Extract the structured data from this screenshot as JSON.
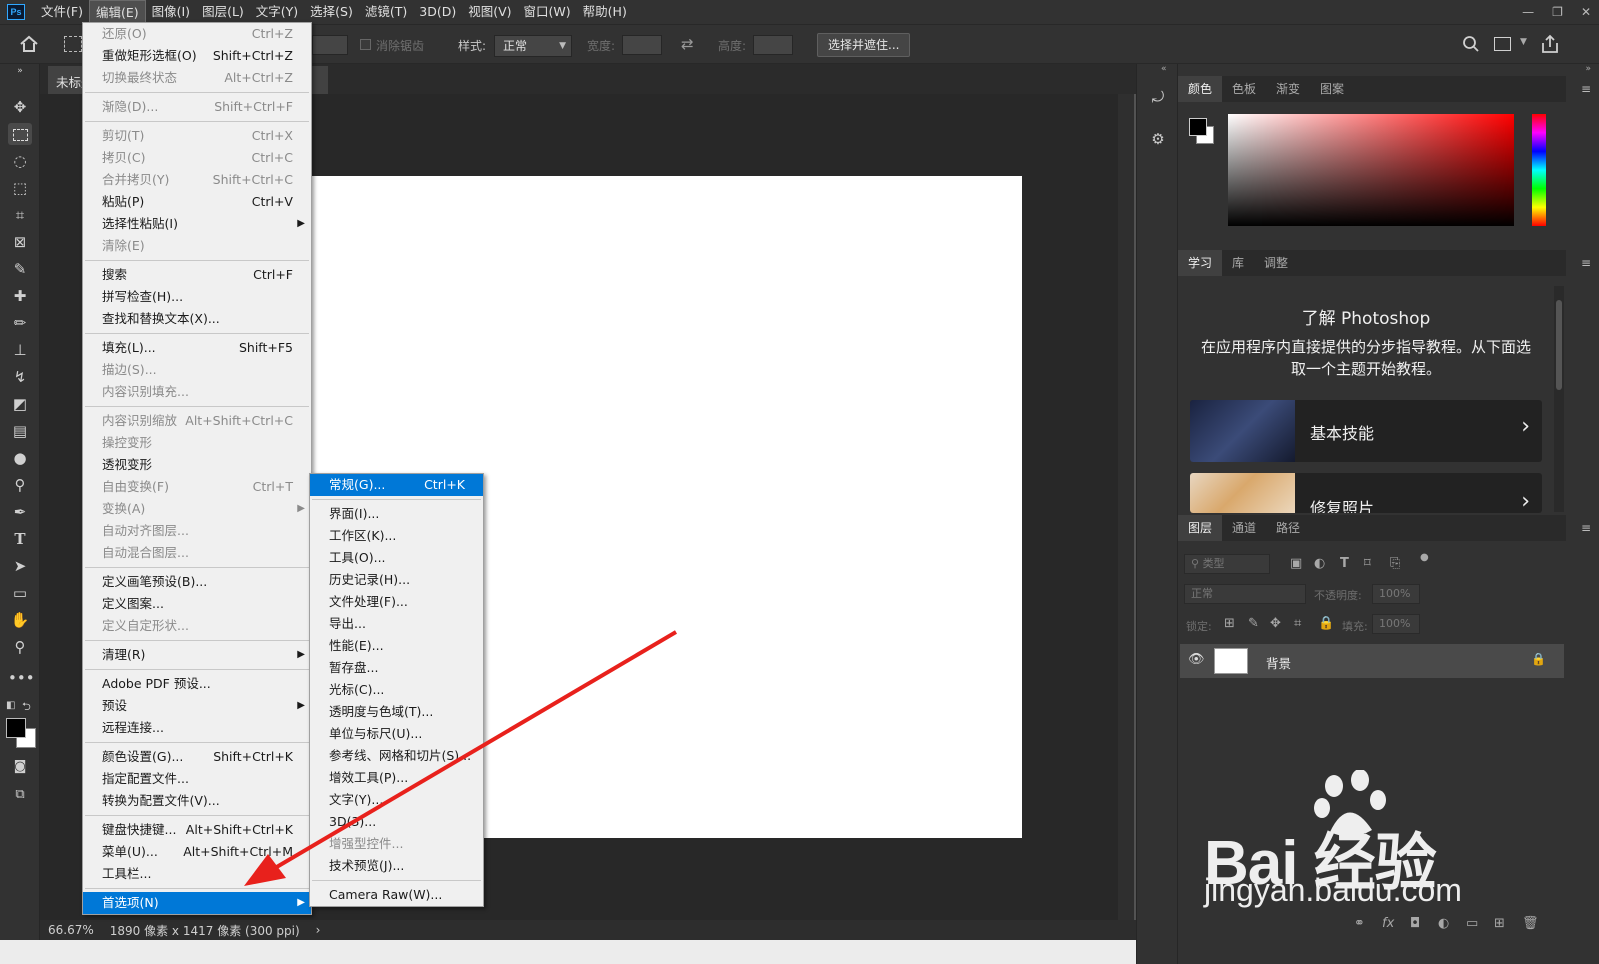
{
  "app": {
    "logo": "Ps"
  },
  "menubar": {
    "items": [
      "文件(F)",
      "编辑(E)",
      "图像(I)",
      "图层(L)",
      "文字(Y)",
      "选择(S)",
      "滤镜(T)",
      "3D(D)",
      "视图(V)",
      "窗口(W)",
      "帮助(H)"
    ],
    "active_index": 1,
    "window_controls": [
      "—",
      "❐",
      "✕"
    ]
  },
  "options": {
    "antialias_label": "消除锯齿",
    "style_label": "样式:",
    "style_value": "正常",
    "width_label": "宽度:",
    "height_label": "高度:",
    "select_mask_button": "选择并遮住..."
  },
  "document": {
    "tab_title": "未标题",
    "zoom": "66.67%",
    "info": "1890 像素 x 1417 像素 (300 ppi)",
    "info_arrow": "›"
  },
  "edit_menu": {
    "items": [
      {
        "label": "还原(O)",
        "shortcut": "Ctrl+Z",
        "disabled": true
      },
      {
        "label": "重做矩形选框(O)",
        "shortcut": "Shift+Ctrl+Z",
        "disabled": false
      },
      {
        "label": "切换最终状态",
        "shortcut": "Alt+Ctrl+Z",
        "disabled": true
      },
      {
        "sep": true
      },
      {
        "label": "渐隐(D)...",
        "shortcut": "Shift+Ctrl+F",
        "disabled": true
      },
      {
        "sep": true
      },
      {
        "label": "剪切(T)",
        "shortcut": "Ctrl+X",
        "disabled": true
      },
      {
        "label": "拷贝(C)",
        "shortcut": "Ctrl+C",
        "disabled": true
      },
      {
        "label": "合并拷贝(Y)",
        "shortcut": "Shift+Ctrl+C",
        "disabled": true
      },
      {
        "label": "粘贴(P)",
        "shortcut": "Ctrl+V",
        "disabled": false
      },
      {
        "label": "选择性粘贴(I)",
        "shortcut": "",
        "disabled": false,
        "submenu": true
      },
      {
        "label": "清除(E)",
        "shortcut": "",
        "disabled": true
      },
      {
        "sep": true
      },
      {
        "label": "搜索",
        "shortcut": "Ctrl+F",
        "disabled": false
      },
      {
        "label": "拼写检查(H)...",
        "shortcut": "",
        "disabled": false
      },
      {
        "label": "查找和替换文本(X)...",
        "shortcut": "",
        "disabled": false
      },
      {
        "sep": true
      },
      {
        "label": "填充(L)...",
        "shortcut": "Shift+F5",
        "disabled": false
      },
      {
        "label": "描边(S)...",
        "shortcut": "",
        "disabled": true
      },
      {
        "label": "内容识别填充...",
        "shortcut": "",
        "disabled": true
      },
      {
        "sep": true
      },
      {
        "label": "内容识别缩放",
        "shortcut": "Alt+Shift+Ctrl+C",
        "disabled": true
      },
      {
        "label": "操控变形",
        "shortcut": "",
        "disabled": true
      },
      {
        "label": "透视变形",
        "shortcut": "",
        "disabled": false
      },
      {
        "label": "自由变换(F)",
        "shortcut": "Ctrl+T",
        "disabled": true
      },
      {
        "label": "变换(A)",
        "shortcut": "",
        "disabled": true,
        "submenu": true
      },
      {
        "label": "自动对齐图层...",
        "shortcut": "",
        "disabled": true
      },
      {
        "label": "自动混合图层...",
        "shortcut": "",
        "disabled": true
      },
      {
        "sep": true
      },
      {
        "label": "定义画笔预设(B)...",
        "shortcut": "",
        "disabled": false
      },
      {
        "label": "定义图案...",
        "shortcut": "",
        "disabled": false
      },
      {
        "label": "定义自定形状...",
        "shortcut": "",
        "disabled": true
      },
      {
        "sep": true
      },
      {
        "label": "清理(R)",
        "shortcut": "",
        "disabled": false,
        "submenu": true
      },
      {
        "sep": true
      },
      {
        "label": "Adobe PDF 预设...",
        "shortcut": "",
        "disabled": false
      },
      {
        "label": "预设",
        "shortcut": "",
        "disabled": false,
        "submenu": true
      },
      {
        "label": "远程连接...",
        "shortcut": "",
        "disabled": false
      },
      {
        "sep": true
      },
      {
        "label": "颜色设置(G)...",
        "shortcut": "Shift+Ctrl+K",
        "disabled": false
      },
      {
        "label": "指定配置文件...",
        "shortcut": "",
        "disabled": false
      },
      {
        "label": "转换为配置文件(V)...",
        "shortcut": "",
        "disabled": false
      },
      {
        "sep": true
      },
      {
        "label": "键盘快捷键...",
        "shortcut": "Alt+Shift+Ctrl+K",
        "disabled": false
      },
      {
        "label": "菜单(U)...",
        "shortcut": "Alt+Shift+Ctrl+M",
        "disabled": false
      },
      {
        "label": "工具栏...",
        "shortcut": "",
        "disabled": false
      },
      {
        "sep": true
      },
      {
        "label": "首选项(N)",
        "shortcut": "",
        "disabled": false,
        "submenu": true,
        "highlighted": true
      }
    ]
  },
  "prefs_menu": {
    "items": [
      {
        "label": "常规(G)...",
        "shortcut": "Ctrl+K",
        "highlighted": true
      },
      {
        "sep": true
      },
      {
        "label": "界面(I)...",
        "shortcut": ""
      },
      {
        "label": "工作区(K)...",
        "shortcut": ""
      },
      {
        "label": "工具(O)...",
        "shortcut": ""
      },
      {
        "label": "历史记录(H)...",
        "shortcut": ""
      },
      {
        "label": "文件处理(F)...",
        "shortcut": ""
      },
      {
        "label": "导出...",
        "shortcut": ""
      },
      {
        "label": "性能(E)...",
        "shortcut": ""
      },
      {
        "label": "暂存盘...",
        "shortcut": ""
      },
      {
        "label": "光标(C)...",
        "shortcut": ""
      },
      {
        "label": "透明度与色域(T)...",
        "shortcut": ""
      },
      {
        "label": "单位与标尺(U)...",
        "shortcut": ""
      },
      {
        "label": "参考线、网格和切片(S)...",
        "shortcut": ""
      },
      {
        "label": "增效工具(P)...",
        "shortcut": ""
      },
      {
        "label": "文字(Y)...",
        "shortcut": ""
      },
      {
        "label": "3D(3)...",
        "shortcut": ""
      },
      {
        "label": "增强型控件...",
        "shortcut": "",
        "disabled": true
      },
      {
        "label": "技术预览(J)...",
        "shortcut": ""
      },
      {
        "sep": true
      },
      {
        "label": "Camera Raw(W)...",
        "shortcut": ""
      }
    ]
  },
  "panels": {
    "color_tabs": [
      "颜色",
      "色板",
      "渐变",
      "图案"
    ],
    "learn_tabs": [
      "学习",
      "库",
      "调整"
    ],
    "learn_title": "了解 Photoshop",
    "learn_desc": "在应用程序内直接提供的分步指导教程。从下面选取一个主题开始教程。",
    "learn_cards": [
      "基本技能",
      "修复照片"
    ],
    "layers_tabs": [
      "图层",
      "通道",
      "路径"
    ],
    "layer_filter_placeholder": "类型",
    "blend_mode": "正常",
    "opacity_label": "不透明度:",
    "opacity_value": "100%",
    "lock_label": "锁定:",
    "fill_label": "填充:",
    "fill_value": "100%",
    "layer_name": "背景"
  },
  "watermark": {
    "main": "Bai 经验",
    "sub": "jingyan.baidu.com"
  },
  "colors": {
    "accent": "#0078d7",
    "arrow": "#e8211c",
    "canvas": "#ffffff",
    "panel": "#323232"
  }
}
